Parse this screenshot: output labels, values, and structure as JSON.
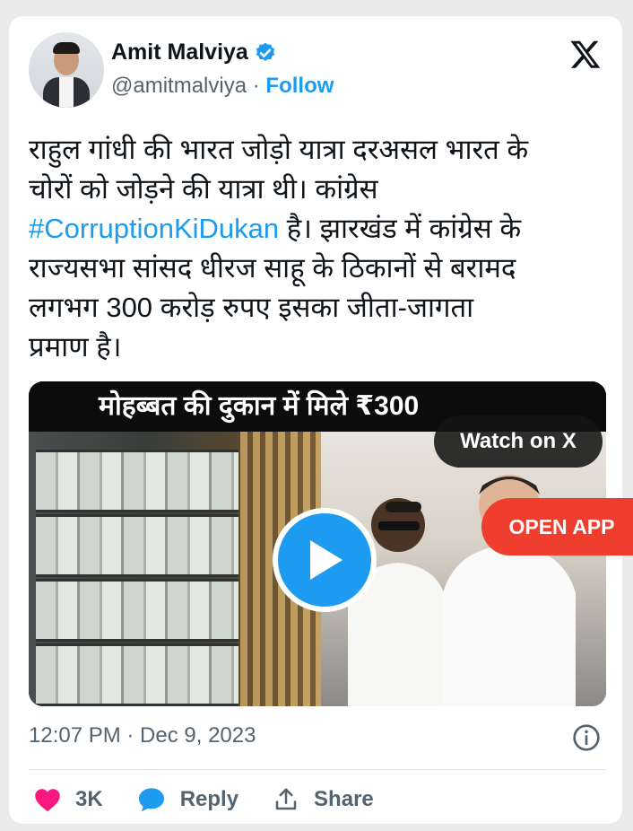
{
  "author": {
    "name": "Amit Malviya",
    "handle": "@amitmalviya",
    "separator": "·",
    "follow_label": "Follow"
  },
  "tweet": {
    "line1": "राहुल गांधी की भारत जोड़ो यात्रा दरअसल भारत के",
    "line2": "चोरों को जोड़ने की यात्रा थी। कांग्रेस",
    "hashtag": "#CorruptionKiDukan",
    "line3_rest": " है। झारखंड में कांग्रेस के",
    "line4": "राज्यसभा सांसद धीरज साहू के ठिकानों से बरामद",
    "line5": "लगभग 300 करोड़ रुपए इसका जीता-जागता",
    "line6": "प्रमाण है।"
  },
  "media": {
    "headline": "मोहब्बत की दुकान में मिले ₹300",
    "watch_label": "Watch on X",
    "open_app_label": "OPEN APP"
  },
  "meta": {
    "timestamp": "12:07 PM · Dec 9, 2023"
  },
  "actions": {
    "likes": "3K",
    "reply_label": "Reply",
    "share_label": "Share"
  },
  "colors": {
    "accent": "#1d9bf0",
    "like": "#f91880",
    "open_app": "#ef3e2e"
  }
}
